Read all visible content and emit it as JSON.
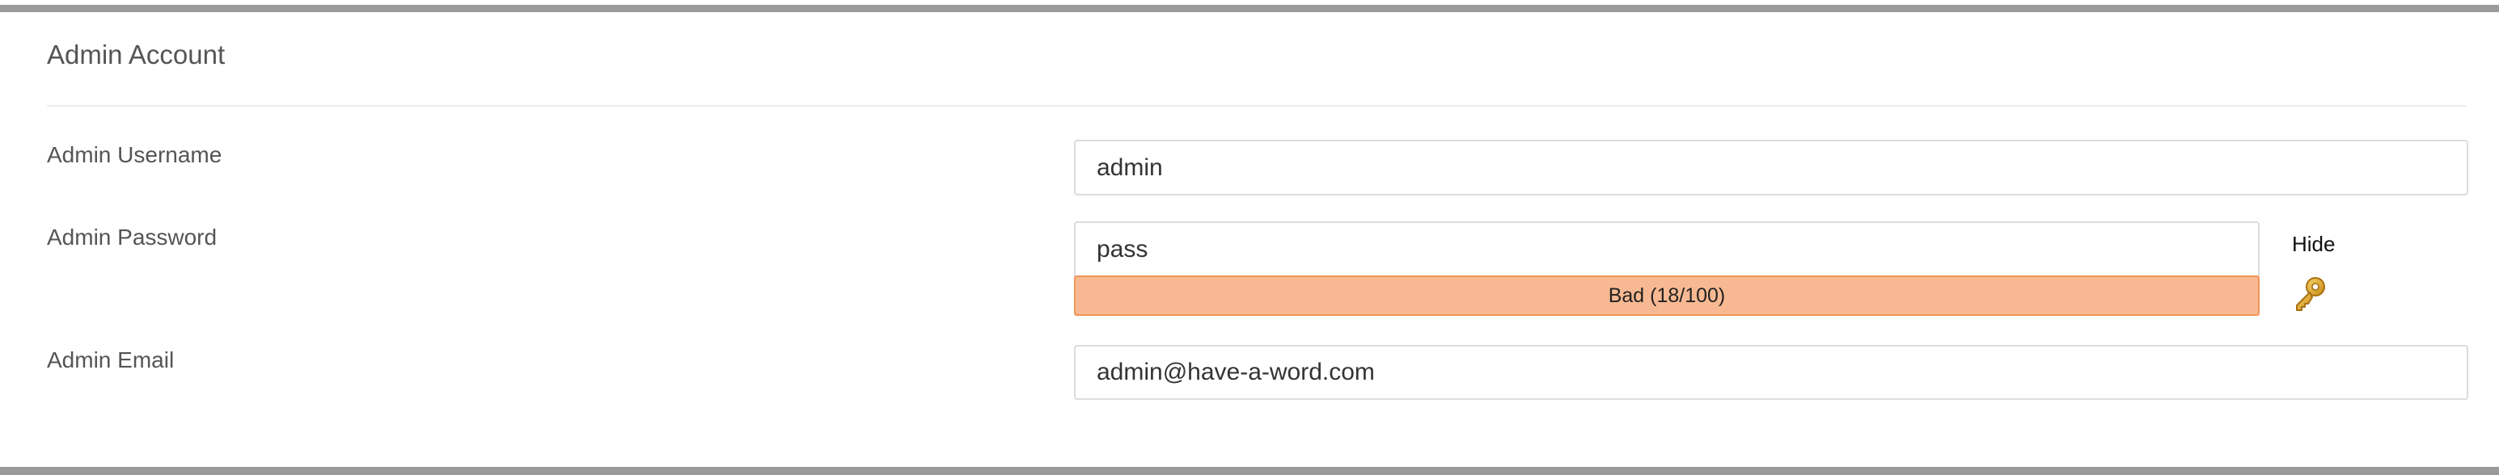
{
  "section": {
    "title": "Admin Account"
  },
  "fields": {
    "username": {
      "label": "Admin Username",
      "value": "admin"
    },
    "password": {
      "label": "Admin Password",
      "value": "pass",
      "strength_text": "Bad (18/100)",
      "strength_score": 18,
      "strength_max": 100,
      "strength_color": "#f8b992",
      "toggle_label": "Hide",
      "generate_icon": "key-icon"
    },
    "email": {
      "label": "Admin Email",
      "value": "admin@have-a-word.com"
    }
  }
}
